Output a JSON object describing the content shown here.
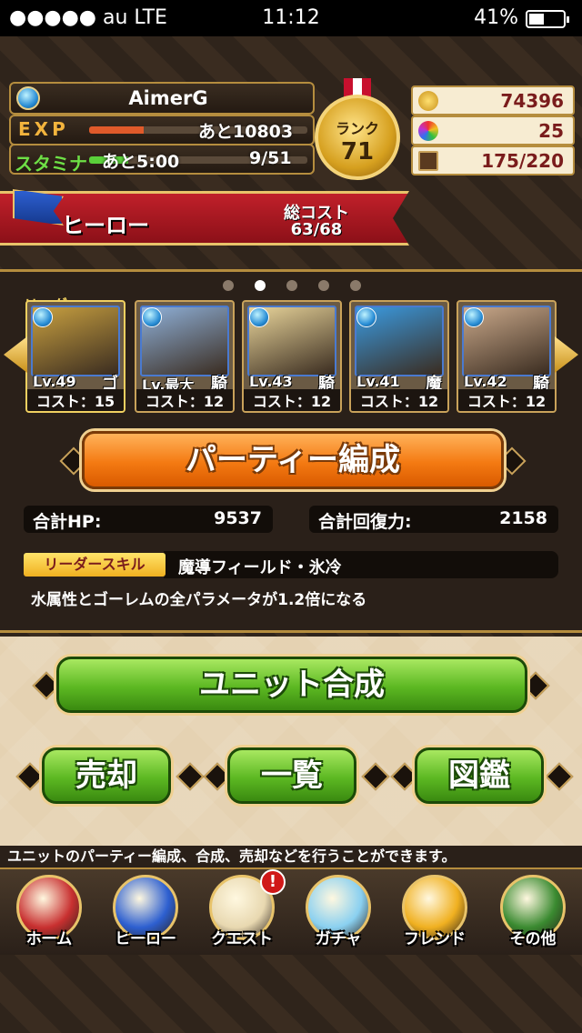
{
  "status_bar": {
    "carrier": "●●●●● au   LTE",
    "time": "11:12",
    "battery": "41%",
    "battery_level": 0.41
  },
  "player": {
    "name": "AimerG",
    "exp_label": "EXP",
    "exp_text": "あと10803",
    "exp_progress": 0.25,
    "stamina_label": "スタミナ",
    "stamina_timer": "あと5:00",
    "stamina_value": "9/51",
    "stamina_progress": 0.18,
    "rank_label": "ランク",
    "rank": "71"
  },
  "resources": {
    "coins": "74396",
    "gems": "25",
    "units": "175/220"
  },
  "party": {
    "name": "ヒーロー",
    "cost_label": "総コスト",
    "cost_value": "63/68",
    "pages": 5,
    "active_page": 2
  },
  "leader_tag": "リーダー",
  "units": [
    {
      "level": "Lv.49",
      "class": "ゴ",
      "cost": "コスト：15",
      "color": "#c8a040"
    },
    {
      "level": "Lv.最大",
      "class": "騎",
      "cost": "コスト：12",
      "color": "#8fb0d8"
    },
    {
      "level": "Lv.43",
      "class": "騎",
      "cost": "コスト：12",
      "color": "#e8d49a"
    },
    {
      "level": "Lv.41",
      "class": "魔",
      "cost": "コスト：12",
      "color": "#3a9ae0"
    },
    {
      "level": "Lv.42",
      "class": "騎",
      "cost": "コスト：12",
      "color": "#c9a88a"
    }
  ],
  "buttons": {
    "party_edit": "パーティー編成",
    "fusion": "ユニット合成",
    "sell": "売却",
    "list": "一覧",
    "book": "図鑑"
  },
  "stats": {
    "hp_label": "合計HP:",
    "hp_value": "9537",
    "heal_label": "合計回復力:",
    "heal_value": "2158"
  },
  "leader_skill": {
    "badge": "リーダースキル",
    "name": "魔導フィールド・氷冷",
    "desc": "水属性とゴーレムの全パラメータが1.2倍になる"
  },
  "hint": "ユニットのパーティー編成、合成、売却などを行うことができます。",
  "tabs": [
    {
      "label": "ホーム",
      "icon": "circus-tent-icon",
      "color": "#c83030"
    },
    {
      "label": "ヒーロー",
      "icon": "blue-flag-icon",
      "color": "#2d5fd0"
    },
    {
      "label": "クエスト",
      "icon": "scroll-map-icon",
      "color": "#e8d8b0"
    },
    {
      "label": "ガチャ",
      "icon": "blue-potion-icon",
      "color": "#8ad0f0"
    },
    {
      "label": "フレンド",
      "icon": "smiley-faces-icon",
      "color": "#f0b020"
    },
    {
      "label": "その他",
      "icon": "green-book-icon",
      "color": "#3a8a30"
    }
  ],
  "quest_badge": "!"
}
